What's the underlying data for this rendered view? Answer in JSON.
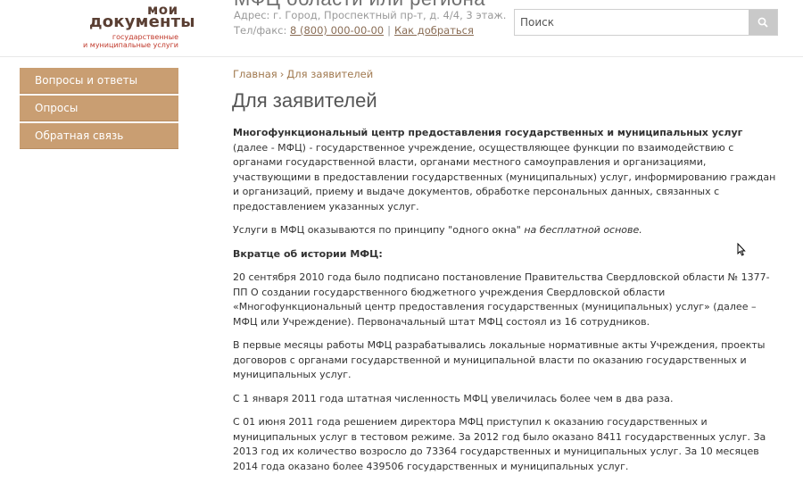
{
  "header": {
    "logo_main": "мои",
    "logo_docs": "документы",
    "logo_sub1": "государственные",
    "logo_sub2": "и муниципальные услуги",
    "title_partial": "МФЦ области или региона",
    "address": "Адрес: г. Город, Проспектный пр-т, д. 4/4, 3 этаж.",
    "phone_label": "Тел/факс",
    "phone": "8 (800) 000-00-00",
    "directions_link": "Как добраться"
  },
  "search": {
    "placeholder": "Поиск"
  },
  "sidebar": {
    "items": [
      {
        "label": "Вопросы и ответы"
      },
      {
        "label": "Опросы"
      },
      {
        "label": "Обратная связь"
      }
    ]
  },
  "breadcrumb": {
    "home": "Главная",
    "current": "Для заявителей"
  },
  "page_title": "Для заявителей",
  "content": {
    "intro_bold": "Многофункциональный центр предоставления государственных и муниципальных услуг",
    "intro_rest": " (далее - МФЦ) - государственное учреждение, осуществляющее функции по взаимодействию с органами государственной власти, органами местного самоуправления и организациями, участвующими в предоставлении государственных (муниципальных) услуг, информированию граждан и организаций, приему и выдаче документов, обработке персональных данных, связанных с предоставлением указанных услуг.",
    "one_window_text": "Услуги в МФЦ оказываются по принципу \"одного окна\" ",
    "one_window_italic": "на бесплатной основе.",
    "history_heading": "Вкратце об истории МФЦ:",
    "history_p1": "20 сентября 2010 года было подписано постановление Правительства Свердловской области № 1377-ПП О создании государственного бюджетного учреждения Свердловской области «Многофункциональный центр предоставления государственных (муниципальных) услуг» (далее – МФЦ или Учреждение). Первоначальный штат МФЦ состоял из 16 сотрудников.",
    "history_p2": "В первые месяцы работы МФЦ разрабатывались локальные нормативные акты Учреждения, проекты договоров с органами государственной и муниципальной власти по оказанию государственных  и муниципальных услуг.",
    "history_p3": "С 1 января 2011 года штатная численность МФЦ увеличилась более чем в два раза.",
    "history_p4": "С 01 июня 2011 года решением директора МФЦ приступил к оказанию государственных и муниципальных услуг в тестовом режиме. За 2012 год было оказано 8411 государственных услуг. За 2013 год их количество возросло до 73364 государственных и муниципальных услуг. За 10 месяцев 2014 года оказано более 439506 государственных и муниципальных услуг."
  },
  "colors": {
    "sidebar_bg": "#c99e72",
    "link": "#a0784e",
    "logo_brown": "#5a3f33",
    "logo_red": "#c0392b"
  },
  "icons": {
    "search": "search-icon",
    "cursor": "mouse-cursor-icon"
  }
}
